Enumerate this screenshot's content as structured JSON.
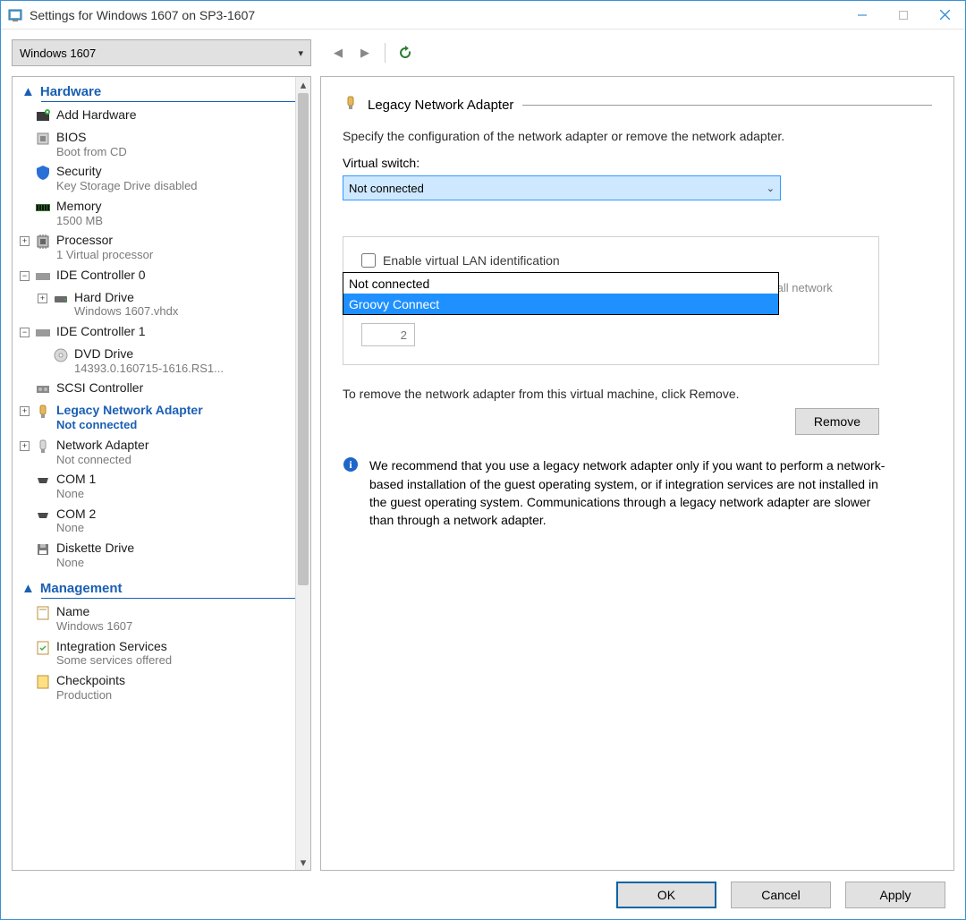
{
  "window": {
    "title": "Settings for Windows 1607 on SP3-1607",
    "minimize": "minimize-icon",
    "maximize": "maximize-icon",
    "close": "close-icon"
  },
  "toolbar": {
    "vm_name": "Windows 1607",
    "back": "back",
    "forward": "forward",
    "refresh": "refresh"
  },
  "tree": {
    "section_hardware": "Hardware",
    "section_management": "Management",
    "items": [
      {
        "label": "Add Hardware",
        "sub": ""
      },
      {
        "label": "BIOS",
        "sub": "Boot from CD"
      },
      {
        "label": "Security",
        "sub": "Key Storage Drive disabled"
      },
      {
        "label": "Memory",
        "sub": "1500 MB"
      },
      {
        "label": "Processor",
        "sub": "1 Virtual processor"
      },
      {
        "label": "IDE Controller 0",
        "sub": ""
      },
      {
        "label": "Hard Drive",
        "sub": "Windows 1607.vhdx"
      },
      {
        "label": "IDE Controller 1",
        "sub": ""
      },
      {
        "label": "DVD Drive",
        "sub": "14393.0.160715-1616.RS1..."
      },
      {
        "label": "SCSI Controller",
        "sub": ""
      },
      {
        "label": "Legacy Network Adapter",
        "sub": "Not connected"
      },
      {
        "label": "Network Adapter",
        "sub": "Not connected"
      },
      {
        "label": "COM 1",
        "sub": "None"
      },
      {
        "label": "COM 2",
        "sub": "None"
      },
      {
        "label": "Diskette Drive",
        "sub": "None"
      }
    ],
    "mgmt": [
      {
        "label": "Name",
        "sub": "Windows 1607"
      },
      {
        "label": "Integration Services",
        "sub": "Some services offered"
      },
      {
        "label": "Checkpoints",
        "sub": "Production"
      }
    ]
  },
  "pane": {
    "title": "Legacy Network Adapter",
    "desc": "Specify the configuration of the network adapter or remove the network adapter.",
    "vswitch_label": "Virtual switch:",
    "vswitch_selected": "Not connected",
    "vswitch_options": [
      "Not connected",
      "Groovy Connect"
    ],
    "vlan_check": "Enable virtual LAN identification",
    "vlan_desc": "The VLAN identifier specifies the virtual LAN that this virtual machine will use for all network communications through this network adapter.",
    "vlan_value": "2",
    "remove_desc": "To remove the network adapter from this virtual machine, click Remove.",
    "remove_btn": "Remove",
    "info": "We recommend that you use a legacy network adapter only if you want to perform a network-based installation of the guest operating system, or if integration services are not installed in the guest operating system. Communications through a legacy network adapter are slower than through a network adapter."
  },
  "footer": {
    "ok": "OK",
    "cancel": "Cancel",
    "apply": "Apply"
  }
}
